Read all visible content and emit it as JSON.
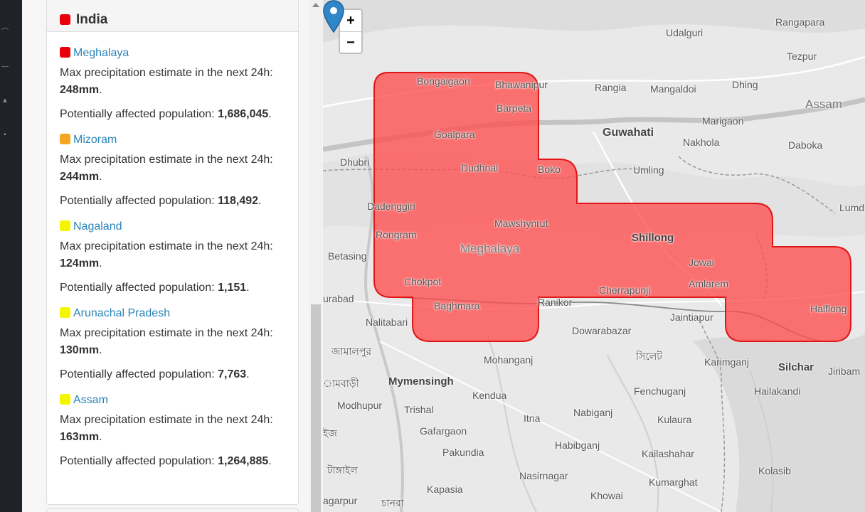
{
  "panel": {
    "country": {
      "name": "India",
      "color": "#e8000b"
    },
    "regions": [
      {
        "name": "Meghalaya",
        "color": "#e8000b",
        "desc_prefix": "Max precipitation estimate in the next 24h:",
        "precip": "248mm",
        "pop_prefix": "Potentially affected population:",
        "population": "1,686,045"
      },
      {
        "name": "Mizoram",
        "color": "#f5a623",
        "desc_prefix": "Max precipitation estimate in the next 24h:",
        "precip": "244mm",
        "pop_prefix": "Potentially affected population:",
        "population": "118,492"
      },
      {
        "name": "Nagaland",
        "color": "#f5f500",
        "desc_prefix": "Max precipitation estimate in the next 24h:",
        "precip": "124mm",
        "pop_prefix": "Potentially affected population:",
        "population": "1,151"
      },
      {
        "name": "Arunachal Pradesh",
        "color": "#f5f500",
        "desc_prefix": "Max precipitation estimate in the next 24h:",
        "precip": "130mm",
        "pop_prefix": "Potentially affected population:",
        "population": "7,763"
      },
      {
        "name": "Assam",
        "color": "#f5f500",
        "desc_prefix": "Max precipitation estimate in the next 24h:",
        "precip": "163mm",
        "pop_prefix": "Potentially affected population:",
        "population": "1,264,885"
      }
    ]
  },
  "map": {
    "zoom_in": "+",
    "zoom_out": "−",
    "area_color": "#ff4d4d",
    "labels": {
      "rangapara": "Rangapara",
      "udalguri": "Udalguri",
      "tezpur": "Tezpur",
      "bongaigaon": "Bongaigaon",
      "bhawanipur": "Bhawanipur",
      "rangia": "Rangia",
      "mangaldoi": "Mangaldoi",
      "dhing": "Dhing",
      "assam": "Assam",
      "barpeta": "Barpeta",
      "goalpara": "Goalpara",
      "guwahati": "Guwahati",
      "marigaon": "Marigaon",
      "nakhola": "Nakhola",
      "daboka": "Daboka",
      "dhubri": "Dhubri",
      "dudhnai": "Dudhnai",
      "boko": "Boko",
      "umling": "Umling",
      "dadenggiri": "Dadenggiri",
      "lumding": "Lumdin",
      "rongram": "Rongram",
      "mawshynrut": "Mawshynrut",
      "shillong": "Shillong",
      "meghalaya": "Meghalaya",
      "betasing": "Betasing",
      "jowai": "Jowai",
      "chokpot": "Chokpot",
      "amlarem": "Amlarem",
      "cherrapunji": "Cherrapunji",
      "urabad": "urabad",
      "ranikor": "Ranikor",
      "baghmara": "Baghmara",
      "jaintiapur": "Jaintiapur",
      "halflong": "Halflong",
      "nalitabari": "Nalitabari",
      "dowarabazar": "Dowarabazar",
      "bengali_1": "জামালপুর",
      "bengali_sylhet": "সিলেট",
      "mohanganj": "Mohanganj",
      "karimganj": "Karimganj",
      "silchar": "Silchar",
      "jiribam": "Jiribam",
      "bengali_2": "ামবাড়ী",
      "mymensingh": "Mymensingh",
      "kendua": "Kendua",
      "fenchuganj": "Fenchuganj",
      "hailakandi": "Hailakandi",
      "modhupur": "Modhupur",
      "trishal": "Trishal",
      "nabiganj": "Nabiganj",
      "itna": "Itna",
      "kulaura": "Kulaura",
      "bengali_3": "ইজ",
      "gafargaon": "Gafargaon",
      "habibganj": "Habibganj",
      "pakundia": "Pakundia",
      "kailashahar": "Kailashahar",
      "kolasib": "Kolasib",
      "bengali_4": "টাঙ্গাইল",
      "nasirnagar": "Nasirnagar",
      "kumarghat": "Kumarghat",
      "kapasia": "Kapasia",
      "agarpur": "agarpur",
      "bengali_5": "চানরা",
      "khowai": "Khowai"
    }
  }
}
